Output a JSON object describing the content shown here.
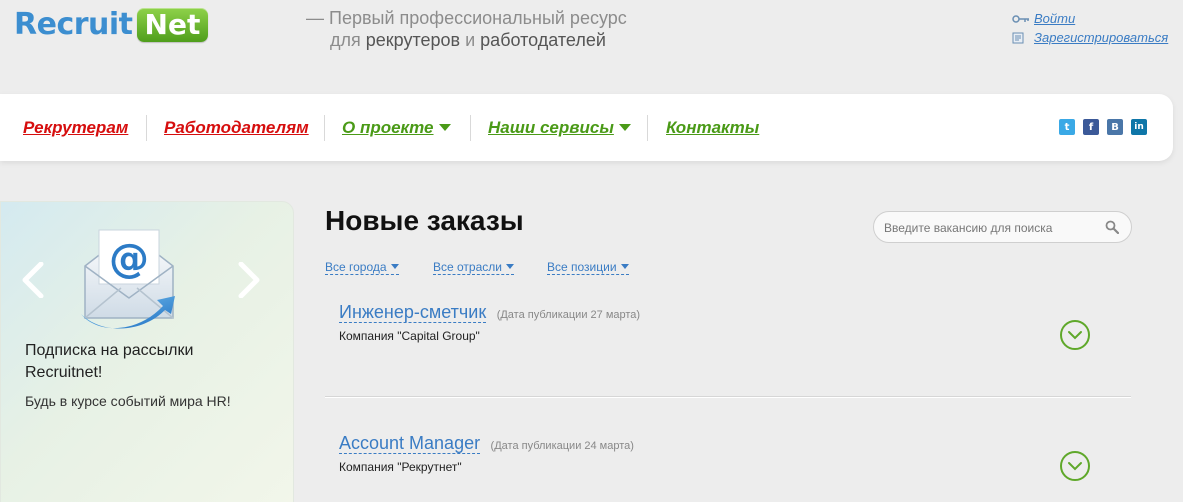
{
  "header": {
    "logo_recruit": "Recruit",
    "logo_net": "Net",
    "tagline_line1": "— Первый профессиональный ресурс",
    "tagline_line2_pre": "для ",
    "tagline_line2_b1": "рекрутеров",
    "tagline_line2_mid": " и ",
    "tagline_line2_b2": "работодателей",
    "login_label": "Войти",
    "register_label": "Зарегистрироваться"
  },
  "nav": {
    "items": [
      {
        "label": "Рекрутерам"
      },
      {
        "label": "Работодателям"
      },
      {
        "label": "О проекте"
      },
      {
        "label": "Наши сервисы"
      },
      {
        "label": "Контакты"
      }
    ],
    "social": {
      "twitter": "t",
      "facebook": "f",
      "vk": "B",
      "linkedin": "in"
    }
  },
  "promo": {
    "title": "Подписка на рассылки Recruitnet!",
    "subtitle": "Будь в курсе событий мира HR!"
  },
  "orders": {
    "title": "Новые заказы",
    "search_placeholder": "Введите вакансию для поиска",
    "filters": [
      {
        "label": "Все города"
      },
      {
        "label": "Все отрасли"
      },
      {
        "label": "Все позиции"
      }
    ],
    "jobs": [
      {
        "title": "Инженер-сметчик",
        "date": "(Дата публикации 27 марта)",
        "company": "Компания \"Capital Group\""
      },
      {
        "title": "Account Manager",
        "date": "(Дата публикации 24 марта)",
        "company": "Компания \"Рекрутнет\""
      }
    ]
  },
  "colors": {
    "brand_blue": "#3c8ed0",
    "brand_green": "#4f9e1c",
    "nav_red": "#d60e0e",
    "nav_green": "#4a9a17",
    "link_blue": "#3a7cc4"
  }
}
